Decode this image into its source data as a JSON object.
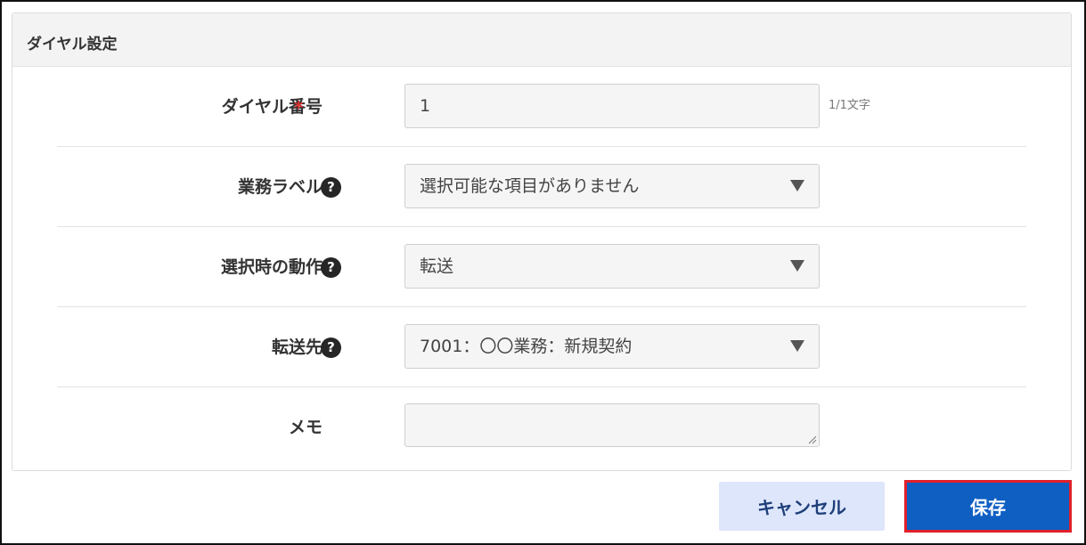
{
  "panel": {
    "title": "ダイヤル設定"
  },
  "form": {
    "dial_number": {
      "label": "ダイヤル番号",
      "required_mark": "*",
      "value": "1",
      "char_count": "1/1文字"
    },
    "business_label": {
      "label": "業務ラベル",
      "help_icon": "question-circle-icon",
      "selected": "選択可能な項目がありません"
    },
    "action_on_select": {
      "label": "選択時の動作",
      "help_icon": "question-circle-icon",
      "selected": "転送"
    },
    "transfer_target": {
      "label": "転送先",
      "help_icon": "question-circle-icon",
      "selected": "7001：〇〇業務：新規契約"
    },
    "memo": {
      "label": "メモ",
      "value": ""
    }
  },
  "buttons": {
    "cancel_label": "キャンセル",
    "save_label": "保存"
  },
  "colors": {
    "save_bg": "#0f5fc3",
    "save_outline": "#e0202a",
    "cancel_bg": "#dde6fb",
    "required": "#e03030"
  }
}
